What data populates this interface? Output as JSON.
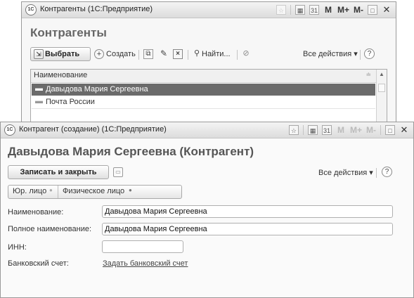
{
  "list_window": {
    "title": "Контрагенты  (1С:Предприятие)",
    "heading": "Контрагенты",
    "toolbar": {
      "choose_label": "Выбрать",
      "create_label": "Создать",
      "find_label": "Найти...",
      "all_actions_label": "Все действия ▾"
    },
    "table": {
      "column_header": "Наименование",
      "rows": [
        "Давыдова Мария Сергеевна",
        "Почта России"
      ]
    }
  },
  "titlebar_buttons": {
    "m": "M",
    "mplus": "M+",
    "mminus": "M-",
    "calendar": "31"
  },
  "form_window": {
    "title": "Контрагент (создание)  (1С:Предприятие)",
    "heading": "Давыдова Мария Сергеевна (Контрагент)",
    "save_close_label": "Записать и закрыть",
    "all_actions_label": "Все действия ▾",
    "toggle": {
      "legal_label": "Юр. лицо",
      "individual_label": "Физическое лицо"
    },
    "fields": {
      "name_label": "Наименование:",
      "name_value": "Давыдова Мария Сергеевна",
      "full_name_label": "Полное наименование:",
      "full_name_value": "Давыдова Мария Сергеевна",
      "inn_label": "ИНН:",
      "inn_value": "",
      "bank_label": "Банковский счет:",
      "bank_link": "Задать банковский счет"
    }
  }
}
